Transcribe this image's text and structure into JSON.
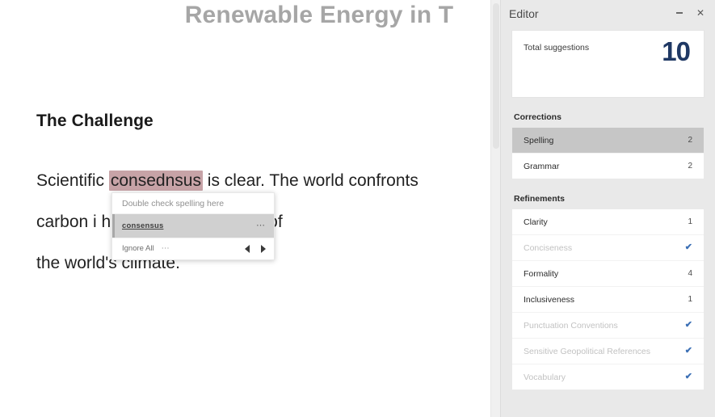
{
  "document": {
    "title": "Renewable Energy in T",
    "heading": "The Challenge",
    "paragraph": {
      "line1_before": "Scientific ",
      "misspelled_word": "consednsus",
      "line1_after": " is clear. The world confronts ",
      "line2": "carbon i                                    has created a blanket of",
      "line3": "the world's climate."
    }
  },
  "spelling_popup": {
    "hint": "Double check spelling here",
    "suggestion": "consensus",
    "suggestion_menu_icon": "ellipsis-icon",
    "ignore_all_label": "Ignore All",
    "ignore_menu_icon": "ellipsis-icon",
    "prev_icon": "triangle-left-icon",
    "next_icon": "triangle-right-icon"
  },
  "editor_panel": {
    "title": "Editor",
    "minimize_icon": "minimize-icon",
    "close_icon": "close-icon",
    "close_glyph": "✕",
    "score_card": {
      "label": "Total suggestions",
      "value": "10"
    },
    "corrections": {
      "title": "Corrections",
      "items": [
        {
          "label": "Spelling",
          "count": "2",
          "selected": true,
          "done": false
        },
        {
          "label": "Grammar",
          "count": "2",
          "selected": false,
          "done": false
        }
      ]
    },
    "refinements": {
      "title": "Refinements",
      "items": [
        {
          "label": "Clarity",
          "count": "1",
          "selected": false,
          "done": false
        },
        {
          "label": "Conciseness",
          "count": "",
          "selected": false,
          "done": true
        },
        {
          "label": "Formality",
          "count": "4",
          "selected": false,
          "done": false
        },
        {
          "label": "Inclusiveness",
          "count": "1",
          "selected": false,
          "done": false
        },
        {
          "label": "Punctuation Conventions",
          "count": "",
          "selected": false,
          "done": true
        },
        {
          "label": "Sensitive Geopolitical References",
          "count": "",
          "selected": false,
          "done": true
        },
        {
          "label": "Vocabulary",
          "count": "",
          "selected": false,
          "done": true
        }
      ],
      "check_glyph": "✔"
    },
    "colors": {
      "panel_bg": "#e9e9e9",
      "accent_blue": "#1f3864",
      "check_blue": "#3b6fb5",
      "selected_row": "#c6c6c6",
      "misspell_highlight": "#c7a3a7"
    }
  }
}
